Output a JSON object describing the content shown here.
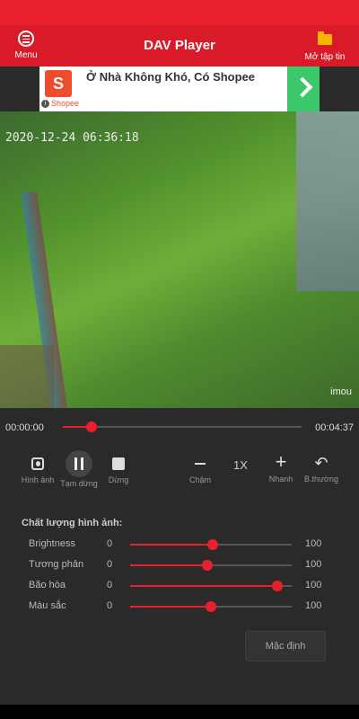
{
  "app": {
    "title": "DAV Player",
    "menu_label": "Menu",
    "open_label": "Mở tập tin"
  },
  "ad": {
    "logo_letter": "S",
    "text": "Ở Nhà Không Khó, Có Shopee",
    "brand": "Shopee"
  },
  "video": {
    "timestamp": "2020-12-24 06:36:18",
    "watermark": "imou"
  },
  "playback": {
    "current": "00:00:00",
    "total": "00:04:37",
    "progress": 0.12
  },
  "controls": {
    "image_label": "Hình ảnh",
    "pause_label": "Tạm dừng",
    "stop_label": "Dừng",
    "slow_label": "Chậm",
    "speed": "1X",
    "fast_label": "Nhanh",
    "normal_label": "B.thường"
  },
  "quality": {
    "title": "Chất lượng hình ảnh:",
    "sliders": [
      {
        "name": "Brightness",
        "min": "0",
        "max": "100",
        "value": 51
      },
      {
        "name": "Tương phản",
        "min": "0",
        "max": "100",
        "value": 48
      },
      {
        "name": "Bão hòa",
        "min": "0",
        "max": "100",
        "value": 91
      },
      {
        "name": "Màu sắc",
        "min": "0",
        "max": "100",
        "value": 50
      }
    ],
    "default_label": "Mặc định"
  },
  "colors": {
    "accent": "#e8202e",
    "appbar": "#d91a28",
    "background": "#2a2a2a"
  }
}
